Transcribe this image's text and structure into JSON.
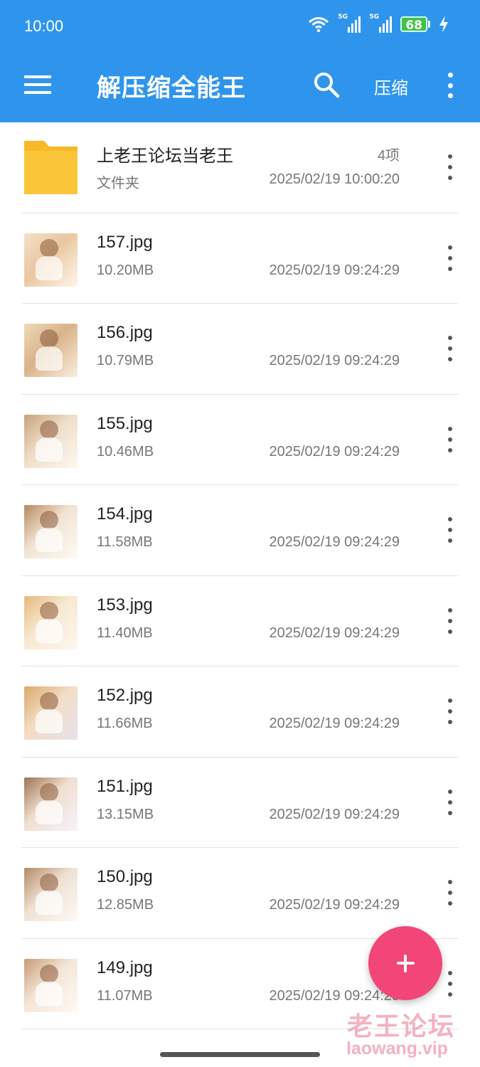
{
  "status_bar": {
    "time": "10:00",
    "network1": "5G",
    "network2": "5G",
    "battery": "68"
  },
  "toolbar": {
    "title": "解压缩全能王",
    "compress_label": "压缩"
  },
  "folder": {
    "name": "上老王论坛当老王",
    "count": "4项",
    "type": "文件夹",
    "date": "2025/02/19 10:00:20"
  },
  "files": [
    {
      "name": "157.jpg",
      "size": "10.20MB",
      "date": "2025/02/19 09:24:29"
    },
    {
      "name": "156.jpg",
      "size": "10.79MB",
      "date": "2025/02/19 09:24:29"
    },
    {
      "name": "155.jpg",
      "size": "10.46MB",
      "date": "2025/02/19 09:24:29"
    },
    {
      "name": "154.jpg",
      "size": "11.58MB",
      "date": "2025/02/19 09:24:29"
    },
    {
      "name": "153.jpg",
      "size": "11.40MB",
      "date": "2025/02/19 09:24:29"
    },
    {
      "name": "152.jpg",
      "size": "11.66MB",
      "date": "2025/02/19 09:24:29"
    },
    {
      "name": "151.jpg",
      "size": "13.15MB",
      "date": "2025/02/19 09:24:29"
    },
    {
      "name": "150.jpg",
      "size": "12.85MB",
      "date": "2025/02/19 09:24:29"
    },
    {
      "name": "149.jpg",
      "size": "11.07MB",
      "date": "2025/02/19 09:24:29"
    }
  ],
  "watermark": {
    "line1": "老王论坛",
    "line2": "laowang.vip"
  },
  "colors": {
    "toolbar": "#2f95ec",
    "fab": "#f14677",
    "folder": "#fbc53a",
    "watermark": "#f3a4b4"
  },
  "icons": {
    "menu": "hamburger-icon",
    "search": "search-icon",
    "more": "more-vert-icon",
    "fab": "plus-icon",
    "folder": "folder-icon"
  }
}
